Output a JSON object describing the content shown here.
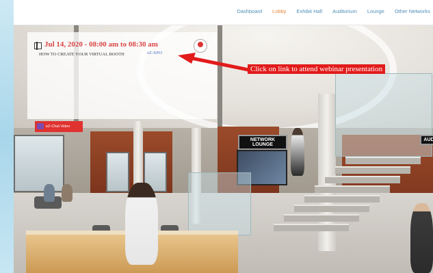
{
  "nav": {
    "items": [
      {
        "label": "Dashboard",
        "active": false
      },
      {
        "label": "Lobby",
        "active": true
      },
      {
        "label": "Exhibit Hall",
        "active": false
      },
      {
        "label": "Auditorium",
        "active": false
      },
      {
        "label": "Lounge",
        "active": false
      },
      {
        "label": "Other Networks",
        "active": false
      }
    ]
  },
  "webinar": {
    "date": "Jul 14, 2020 - 08:00 am to 08:30 am",
    "title": "HOW TO CREATE YOUR VIRTUAL BOOTH",
    "link": "eZ-XPO",
    "icon": "film-icon"
  },
  "callout": {
    "text": "Click on link to attend webinar presentation"
  },
  "chat": {
    "label": "eZ-Chat Video",
    "icon": "chat-video-icon"
  },
  "signs": {
    "network_lounge": "NETWORK LOUNGE",
    "auditorium": "AUD"
  },
  "colors": {
    "accent": "#e3863c",
    "nav_link": "#4f8fb8",
    "callout": "#e21b1b",
    "date": "#d94545"
  }
}
